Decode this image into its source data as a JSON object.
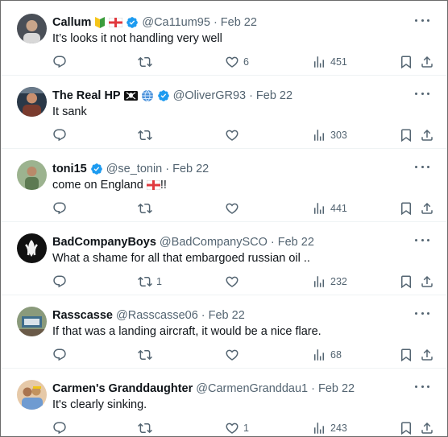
{
  "tweets": [
    {
      "name": "Callum",
      "badges": [
        "beginner",
        "england-flag",
        "verified"
      ],
      "handle": "@Ca11um95",
      "date": "Feb 22",
      "text": "It’s looks it not handling very well",
      "text_after": "",
      "replies": "",
      "retweets": "",
      "likes": "6",
      "views": "451",
      "avatar_bg": "#4a4f57"
    },
    {
      "name": "The Real HP",
      "badges": [
        "pirate-flag",
        "globe",
        "verified"
      ],
      "handle": "@OliverGR93",
      "date": "Feb 22",
      "text": "It sank",
      "text_after": "",
      "replies": "",
      "retweets": "",
      "likes": "",
      "views": "303",
      "avatar_bg": "#7a3b2e"
    },
    {
      "name": "toni15",
      "badges": [
        "verified"
      ],
      "handle": "@se_tonin",
      "date": "Feb 22",
      "text": "come on England ",
      "text_after": "!!",
      "inline_flag": true,
      "replies": "",
      "retweets": "",
      "likes": "",
      "views": "441",
      "avatar_bg": "#5d7a52"
    },
    {
      "name": "BadCompanyBoys",
      "badges": [],
      "handle": "@BadCompanySCO",
      "date": "Feb 22",
      "text": "What a shame for all that embargoed russian oil ..",
      "text_after": "",
      "replies": "",
      "retweets": "1",
      "likes": "",
      "views": "232",
      "avatar_bg": "#111111"
    },
    {
      "name": "Rasscasse",
      "badges": [],
      "handle": "@Rasscasse06",
      "date": "Feb 22",
      "text": "If that was a landing aircraft, it would be a nice flare.",
      "text_after": "",
      "replies": "",
      "retweets": "",
      "likes": "",
      "views": "68",
      "avatar_bg": "#8a9a7b"
    },
    {
      "name": "Carmen's Granddaughter",
      "badges": [],
      "handle": "@CarmenGranddau1",
      "date": "Feb 22",
      "text": "It's clearly sinking.",
      "text_after": "",
      "replies": "",
      "retweets": "",
      "likes": "1",
      "views": "243",
      "avatar_bg": "#c49a6c"
    }
  ],
  "colors": {
    "verified": "#1d9bf0",
    "icon": "#536471",
    "text": "#0f1419"
  },
  "icons": [
    "reply-icon",
    "retweet-icon",
    "like-icon",
    "views-icon",
    "bookmark-icon",
    "share-icon",
    "more-icon",
    "verified-icon",
    "england-flag-icon",
    "pirate-flag-icon",
    "globe-icon",
    "beginner-icon"
  ]
}
